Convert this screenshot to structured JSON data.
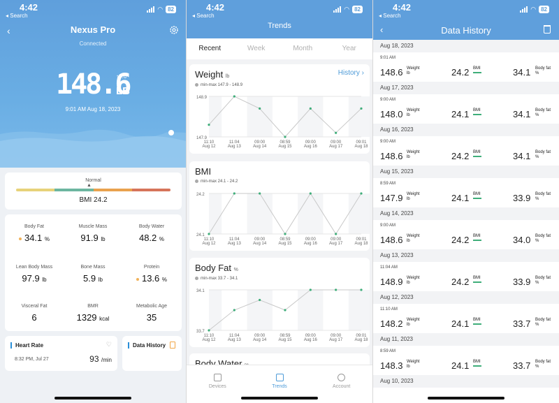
{
  "status": {
    "time": "4:42",
    "back": "◂ Search",
    "battery": "82"
  },
  "p1": {
    "device_title": "Nexus Pro",
    "connection": "Connected",
    "weight": "148.6",
    "unit": "LB",
    "delta": "↑0.6",
    "datetime": "9:01 AM   Aug 18, 2023",
    "bmi_status": "Normal",
    "bmi_text": "BMI 24.2",
    "bmi_colors": [
      "#e7d27a",
      "#6cb6a0",
      "#e9a24e",
      "#d6745a"
    ],
    "metrics": [
      {
        "label": "Body Fat",
        "value": "34.1",
        "unit": "%",
        "dot": true
      },
      {
        "label": "Muscle Mass",
        "value": "91.9",
        "unit": "lb",
        "dot": false
      },
      {
        "label": "Body Water",
        "value": "48.2",
        "unit": "%",
        "dot": false
      },
      {
        "label": "Lean Body Mass",
        "value": "97.9",
        "unit": "lb",
        "dot": false
      },
      {
        "label": "Bone Mass",
        "value": "5.9",
        "unit": "lb",
        "dot": false
      },
      {
        "label": "Protein",
        "value": "13.6",
        "unit": "%",
        "dot": true
      },
      {
        "label": "Visceral Fat",
        "value": "6",
        "unit": "",
        "dot": false
      },
      {
        "label": "BMR",
        "value": "1329",
        "unit": "kcal",
        "dot": false
      },
      {
        "label": "Metabolic Age",
        "value": "35",
        "unit": "",
        "dot": false
      }
    ],
    "heart_rate": {
      "title": "Heart Rate",
      "time": "8:32 PM, Jul 27",
      "value": "93",
      "unit": "/min"
    },
    "data_history": "Data History"
  },
  "p2": {
    "title": "Trends",
    "tabs": [
      "Recent",
      "Week",
      "Month",
      "Year"
    ],
    "history_link": "History",
    "x_labels": [
      [
        "11:10",
        "Aug 12"
      ],
      [
        "11:04",
        "Aug 13"
      ],
      [
        "09:00",
        "Aug 14"
      ],
      [
        "08:59",
        "Aug 15"
      ],
      [
        "09:00",
        "Aug 16"
      ],
      [
        "09:00",
        "Aug 17"
      ],
      [
        "09:01",
        "Aug 18"
      ]
    ],
    "weight": {
      "title": "Weight",
      "unit": "lb",
      "range": "min-max  147.9 - 148.9",
      "ymax": "148.9",
      "ymin": "147.9",
      "values": [
        148.2,
        148.9,
        148.6,
        147.9,
        148.6,
        148.0,
        148.6
      ]
    },
    "bmi": {
      "title": "BMI",
      "unit": "",
      "range": "min-max  24.1 - 24.2",
      "ymax": "24.2",
      "ymin": "24.1",
      "values": [
        24.1,
        24.2,
        24.2,
        24.1,
        24.2,
        24.1,
        24.2
      ]
    },
    "bodyfat": {
      "title": "Body Fat",
      "unit": "%",
      "range": "min-max  33.7 - 34.1",
      "ymax": "34.1",
      "ymin": "33.7",
      "values": [
        33.7,
        33.9,
        34.0,
        33.9,
        34.1,
        34.1,
        34.1
      ]
    },
    "water": {
      "title": "Body Water",
      "unit": "%"
    },
    "nav": [
      "Devices",
      "Trends",
      "Account"
    ]
  },
  "p3": {
    "title": "Data History",
    "labels": {
      "weight": "Weight",
      "weight_unit": "lb",
      "bmi": "BMI",
      "fat": "Body fat",
      "fat_unit": "%"
    },
    "days": [
      {
        "date": "Aug 18, 2023",
        "time": "9:01 AM",
        "weight": "148.6",
        "bmi": "24.2",
        "fat": "34.1"
      },
      {
        "date": "Aug 17, 2023",
        "time": "9:00 AM",
        "weight": "148.0",
        "bmi": "24.1",
        "fat": "34.1"
      },
      {
        "date": "Aug 16, 2023",
        "time": "9:00 AM",
        "weight": "148.6",
        "bmi": "24.2",
        "fat": "34.1"
      },
      {
        "date": "Aug 15, 2023",
        "time": "8:59 AM",
        "weight": "147.9",
        "bmi": "24.1",
        "fat": "33.9"
      },
      {
        "date": "Aug 14, 2023",
        "time": "9:00 AM",
        "weight": "148.6",
        "bmi": "24.2",
        "fat": "34.0"
      },
      {
        "date": "Aug 13, 2023",
        "time": "11:04 AM",
        "weight": "148.9",
        "bmi": "24.2",
        "fat": "33.9"
      },
      {
        "date": "Aug 12, 2023",
        "time": "11:10 AM",
        "weight": "148.2",
        "bmi": "24.1",
        "fat": "33.7"
      },
      {
        "date": "Aug 11, 2023",
        "time": "8:59 AM",
        "weight": "148.3",
        "bmi": "24.1",
        "fat": "33.7"
      }
    ],
    "last_date": "Aug 10, 2023"
  }
}
